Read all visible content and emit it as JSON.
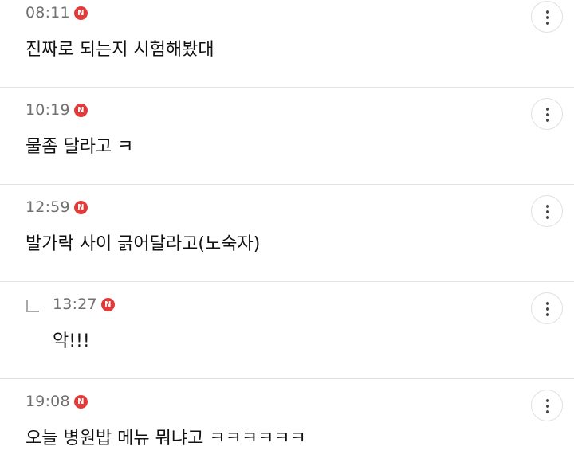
{
  "badge_label": "N",
  "colors": {
    "badge": "#e23a3a",
    "time": "#707070",
    "text": "#111111",
    "divider": "#e2e2e2"
  },
  "icons": {
    "more": "vertical-ellipsis-icon",
    "reply": "reply-arrow-icon",
    "new": "new-badge-icon"
  },
  "comments": [
    {
      "time": "08:11",
      "text": "진짜로 되는지 시험해봤대",
      "is_reply": false
    },
    {
      "time": "10:19",
      "text": "물좀 달라고 ㅋ",
      "is_reply": false
    },
    {
      "time": "12:59",
      "text": "발가락 사이 긁어달라고(노숙자)",
      "is_reply": false
    },
    {
      "time": "13:27",
      "text": "악!!!",
      "is_reply": true
    },
    {
      "time": "19:08",
      "text": "오늘 병원밥 메뉴 뭐냐고 ㅋㅋㅋㅋㅋㅋ",
      "is_reply": false
    }
  ]
}
